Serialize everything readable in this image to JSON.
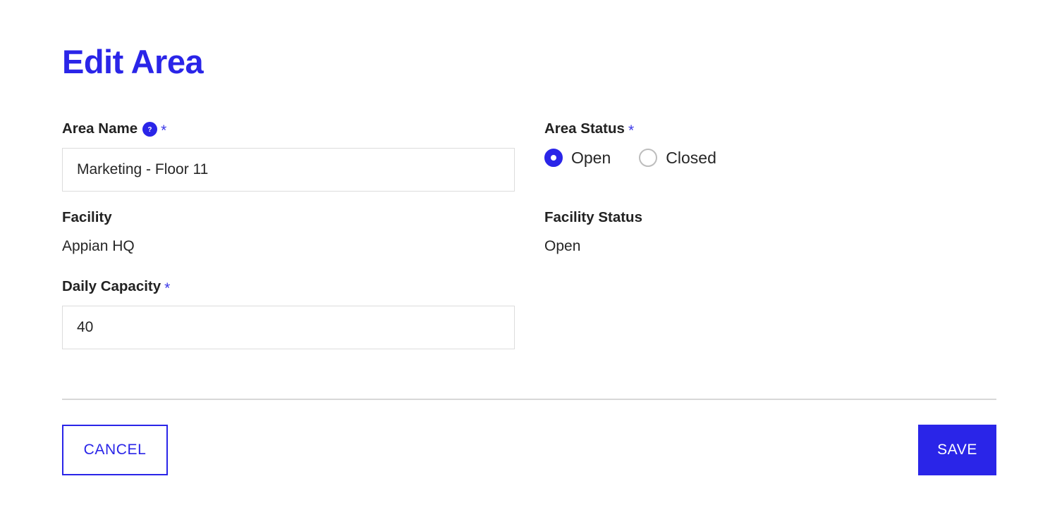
{
  "page": {
    "title": "Edit Area"
  },
  "colors": {
    "accent": "#2A25E8",
    "text": "#222222",
    "input_border": "#dcdcdc",
    "divider": "#d8d8d8",
    "radio_unchecked_border": "#bdbdbd"
  },
  "fields": {
    "area_name": {
      "label": "Area Name",
      "required_marker": "*",
      "help_icon": "help-circle-icon",
      "value": "Marketing - Floor 11",
      "placeholder": ""
    },
    "area_status": {
      "label": "Area Status",
      "required_marker": "*",
      "selected": "Open",
      "options": [
        {
          "label": "Open",
          "checked": true
        },
        {
          "label": "Closed",
          "checked": false
        }
      ]
    },
    "facility": {
      "label": "Facility",
      "value": "Appian HQ"
    },
    "facility_status": {
      "label": "Facility Status",
      "value": "Open"
    },
    "daily_capacity": {
      "label": "Daily Capacity",
      "required_marker": "*",
      "value": "40",
      "placeholder": ""
    }
  },
  "footer": {
    "cancel_label": "CANCEL",
    "save_label": "SAVE"
  }
}
